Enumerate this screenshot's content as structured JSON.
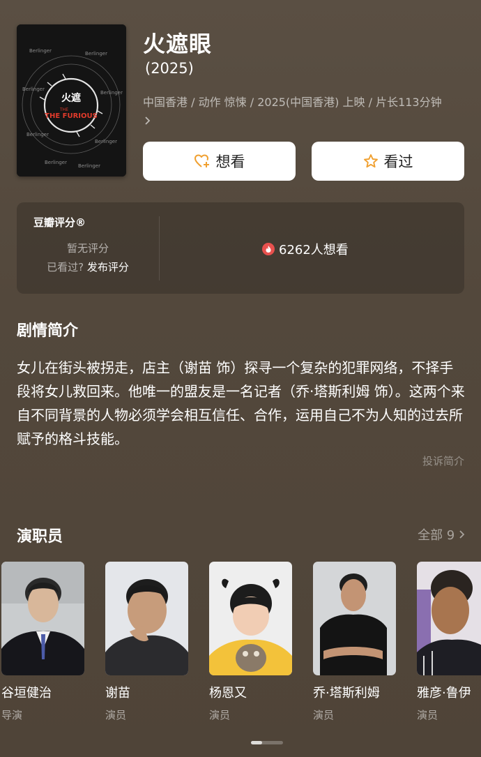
{
  "movie": {
    "title": "火遮眼",
    "year": "(2025)",
    "meta": "中国香港 / 动作 惊悚 / 2025(中国香港) 上映 / 片长113分钟",
    "poster_title": "THE FURIOUS"
  },
  "actions": {
    "want_label": "想看",
    "seen_label": "看过"
  },
  "rating": {
    "brand": "豆瓣评分®",
    "no_rating": "暂无评分",
    "seen_prompt": "已看过?",
    "rate_link": "发布评分",
    "want_count": "6262人想看"
  },
  "synopsis": {
    "heading": "剧情简介",
    "text": "女儿在街头被拐走，店主（谢苗 饰）探寻一个复杂的犯罪网络，不择手段将女儿救回来。他唯一的盟友是一名记者（乔·塔斯利姆 饰）。这两个来自不同背景的人物必须学会相互信任、合作，运用自己不为人知的过去所赋予的格斗技能。",
    "report": "投诉简介"
  },
  "cast": {
    "heading": "演职员",
    "all_label": "全部 9",
    "members": [
      {
        "name": "谷垣健治",
        "role": "导演"
      },
      {
        "name": "谢苗",
        "role": "演员"
      },
      {
        "name": "杨恩又",
        "role": "演员"
      },
      {
        "name": "乔·塔斯利姆",
        "role": "演员"
      },
      {
        "name": "雅彦·鲁伊",
        "role": "演员"
      }
    ]
  },
  "colors": {
    "background": "#54493d",
    "heart_icon": "#f0a030",
    "star_icon": "#f0a030",
    "fire_badge": "#e8514e"
  }
}
